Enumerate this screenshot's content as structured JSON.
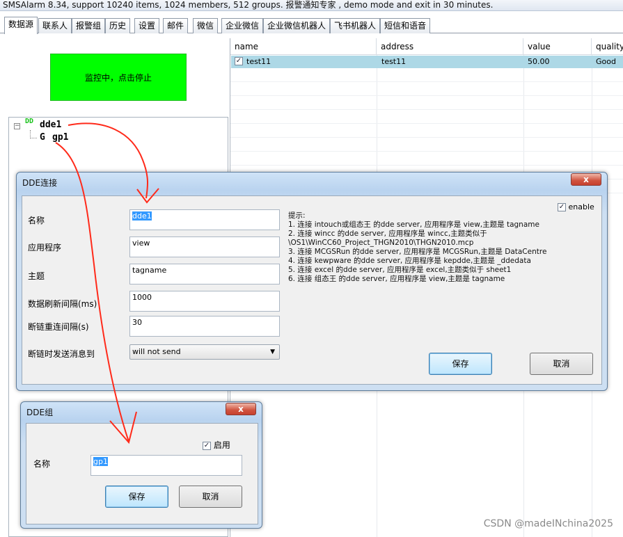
{
  "window": {
    "title": "SMSAlarm 8.34, support 10240 items, 1024 members, 512 groups. 报警通知专家 , demo mode and exit in 30 minutes."
  },
  "tabs": [
    {
      "label": "数据源",
      "active": true
    },
    {
      "label": "联系人"
    },
    {
      "label": "报警组"
    },
    {
      "label": "历史"
    },
    {
      "label": "设置"
    },
    {
      "label": "邮件"
    },
    {
      "label": "微信"
    },
    {
      "label": "企业微信"
    },
    {
      "label": "企业微信机器人"
    },
    {
      "label": "飞书机器人"
    },
    {
      "label": "短信和语音"
    }
  ],
  "left": {
    "monitor_button": "监控中，点击停止",
    "monitor_color": "#00ff00",
    "tree": {
      "expander": "⊟",
      "connection": {
        "icon": "dde-icon",
        "icon_text": "DD",
        "label": "dde1"
      },
      "group": {
        "icon": "group-icon",
        "icon_text": "G",
        "label": "gp1"
      }
    }
  },
  "grid": {
    "headers": [
      "name",
      "address",
      "value",
      "quality"
    ],
    "rows": [
      {
        "checked": true,
        "name": "test11",
        "address": "test11",
        "value": "50.00",
        "quality": "Good"
      }
    ],
    "selected_row_color": "#add8e6"
  },
  "dde_dialog": {
    "title": "DDE连接",
    "close": "x",
    "enable_label": "enable",
    "enable_checked": true,
    "fields": {
      "name_label": "名称",
      "name_value": "dde1",
      "app_label": "应用程序",
      "app_value": "view",
      "topic_label": "主题",
      "topic_value": "tagname",
      "refresh_label": "数据刷新间隔(ms)",
      "refresh_value": "1000",
      "reconnect_label": "断链重连间隔(s)",
      "reconnect_value": "30",
      "notify_label": "断链时发送消息到",
      "notify_value": "will not send"
    },
    "hints": [
      "提示:",
      "1. 连接 intouch或组态王 的dde server, 应用程序是 view,主题是 tagname",
      "2. 连接 wincc 的dde server, 应用程序是 wincc,主题类似于",
      "\\OS1\\WinCC60_Project_THGN2010\\THGN2010.mcp",
      "3. 连接 MCGSRun 的dde server, 应用程序是 MCGSRun,主题是 DataCentre",
      "4. 连接 kewpware 的dde server, 应用程序是 kepdde,主题是 _ddedata",
      "5. 连接 excel 的dde server, 应用程序是 excel,主题类似于 sheet1",
      "6. 连接 组态王 的dde server, 应用程序是 view,主题是 tagname"
    ],
    "save": "保存",
    "cancel": "取消"
  },
  "group_dialog": {
    "title": "DDE组",
    "close": "x",
    "enable_label": "启用",
    "enable_checked": true,
    "name_label": "名称",
    "name_value": "gp1",
    "save": "保存",
    "cancel": "取消"
  },
  "watermark": "CSDN @madeINchina2025",
  "annotation_color": "#ff2a1a"
}
